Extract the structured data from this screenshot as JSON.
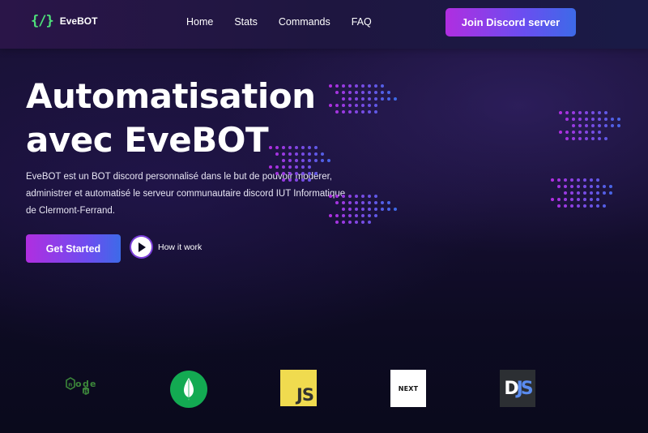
{
  "brand": {
    "mark": "{/}",
    "name": "EveBOT"
  },
  "nav": {
    "items": [
      "Home",
      "Stats",
      "Commands",
      "FAQ"
    ]
  },
  "header": {
    "join_label": "Join Discord server"
  },
  "hero": {
    "title_line1": "Automatisation",
    "title_line2": "avec EveBOT",
    "description": "EveBOT est un BOT discord personnalisé dans le but de pouvoir modérer, administrer et automatisé le serveur communautaire discord IUT Informatique de Clermont-Ferrand.",
    "cta_label": "Get Started",
    "how_label": "How it work"
  },
  "logos": {
    "js_text": "JS",
    "next_text": "NEXT",
    "djs_d": "D",
    "djs_js": "JS",
    "items": [
      "node-js",
      "mongodb",
      "javascript",
      "nextjs",
      "discord-js"
    ]
  },
  "colors": {
    "accent_purple": "#b02ee0",
    "accent_blue": "#3d6ae8",
    "brand_green": "#4ee07a"
  }
}
